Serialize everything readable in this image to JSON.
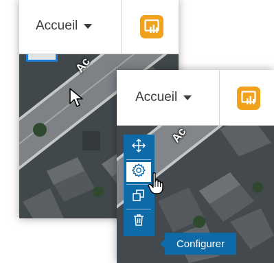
{
  "back_window": {
    "home_menu_label": "Accueil",
    "app_icon": "dashboard-app-icon",
    "road_label": "Ac"
  },
  "front_window": {
    "home_menu_label": "Accueil",
    "app_icon": "dashboard-app-icon",
    "road_label": "Ac",
    "toolbar": {
      "tools": [
        "move-icon",
        "gear-icon",
        "duplicate-icon",
        "trash-icon"
      ],
      "active_tool": "gear-icon"
    },
    "tooltip": "Configurer"
  },
  "colors": {
    "accent": "#0e6ba8",
    "app_icon": "#f1a21d"
  }
}
